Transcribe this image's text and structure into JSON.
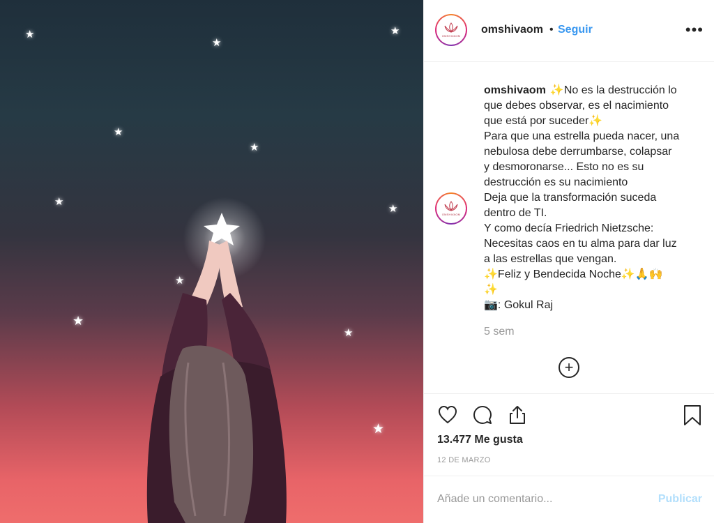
{
  "post": {
    "username": "omshivaom",
    "separator": "•",
    "follow_label": "Seguir",
    "more_icon": "more-horizontal-icon",
    "avatar_text": "OMSHIVAOM"
  },
  "caption": {
    "username": "omshivaom",
    "lines": [
      "No es la destrucción lo",
      "que debes observar, es el nacimiento",
      "que está por suceder",
      "Para que una estrella pueda nacer, una",
      "nebulosa debe derrumbarse, colapsar",
      "y desmoronarse... Esto no es su",
      "destrucción es su nacimiento",
      "Deja que la transformación suceda",
      "dentro de TI.",
      "Y como decía Friedrich Nietzsche:",
      "Necesitas caos en tu alma para dar luz",
      "a las estrellas que vengan.",
      "Feliz y Bendecida Noche",
      "",
      ": Gokul Raj"
    ],
    "emoji": {
      "sparkles": "✨",
      "pray": "🙏",
      "raised_hands": "🙌",
      "camera": "📷"
    },
    "age": "5 sem"
  },
  "actions": {
    "like_icon": "heart-icon",
    "comment_icon": "comment-icon",
    "share_icon": "share-icon",
    "save_icon": "bookmark-icon",
    "load_more_icon": "plus-circle-icon"
  },
  "likes": "13.477 Me gusta",
  "date": "12 DE MARZO",
  "comment": {
    "placeholder": "Añade un comentario...",
    "publish_label": "Publicar"
  },
  "colors": {
    "accent": "#3897f0",
    "publish_disabled": "#b2dffc",
    "muted": "#999999"
  }
}
